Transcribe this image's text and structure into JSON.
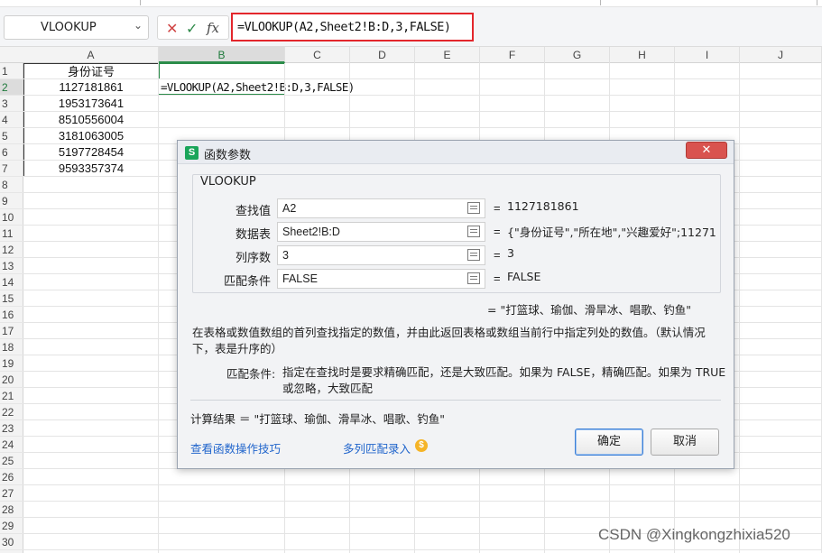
{
  "formula_bar": {
    "name_box": "VLOOKUP",
    "formula": "=VLOOKUP(A2,Sheet2!B:D,3,FALSE)",
    "icons": [
      "cancel-icon",
      "enter-icon",
      "insert-function-icon"
    ]
  },
  "sheet": {
    "columns": [
      "A",
      "B",
      "C",
      "D",
      "E",
      "F",
      "G",
      "H",
      "I",
      "J"
    ],
    "rows": [
      "1",
      "2",
      "3",
      "4",
      "5",
      "6",
      "7",
      "8",
      "9",
      "10",
      "11",
      "12",
      "13",
      "14",
      "15",
      "16",
      "17",
      "18",
      "19",
      "20",
      "21",
      "22",
      "23",
      "24",
      "25",
      "26",
      "27",
      "28",
      "29",
      "30"
    ],
    "a_header": "身份证号",
    "a_values": [
      "1127181861",
      "1953173641",
      "8510556004",
      "3181063005",
      "5197728454",
      "9593357374"
    ],
    "b2_formula": "=VLOOKUP(A2,Sheet2!B:D,3,FALSE)",
    "selected_column": "B",
    "selected_row": "2"
  },
  "dialog": {
    "title": "函数参数",
    "logo": "S",
    "close": "✕",
    "function_name": "VLOOKUP",
    "args": [
      {
        "label": "查找值",
        "value": "A2",
        "result": "1127181861"
      },
      {
        "label": "数据表",
        "value": "Sheet2!B:D",
        "result": "{\"身份证号\",\"所在地\",\"兴趣爱好\";112718..."
      },
      {
        "label": "列序数",
        "value": "3",
        "result": "3"
      },
      {
        "label": "匹配条件",
        "value": "FALSE",
        "result": "FALSE"
      }
    ],
    "eq": "=",
    "result_line": "= \"打篮球、瑜伽、滑旱冰、唱歌、钓鱼\"",
    "description": "在表格或数值数组的首列查找指定的数值，并由此返回表格或数组当前行中指定列处的数值。（默认情况下，表是升序的）",
    "arg_desc_label": "匹配条件:",
    "arg_desc": "指定在查找时是要求精确匹配，还是大致匹配。如果为 FALSE，精确匹配。如果为 TRUE 或忽略，大致匹配",
    "calc_result": "计算结果 ＝ \"打篮球、瑜伽、滑旱冰、唱歌、钓鱼\"",
    "link_tips": "查看函数操作技巧",
    "link_multi": "多列匹配录入",
    "coin": "$",
    "ok": "确定",
    "cancel": "取消"
  },
  "watermark": "CSDN @Xingkongzhixia520",
  "colors": {
    "accent_green": "#2b8c4a",
    "highlight_red": "#e3262c",
    "link_blue": "#2266cc"
  }
}
